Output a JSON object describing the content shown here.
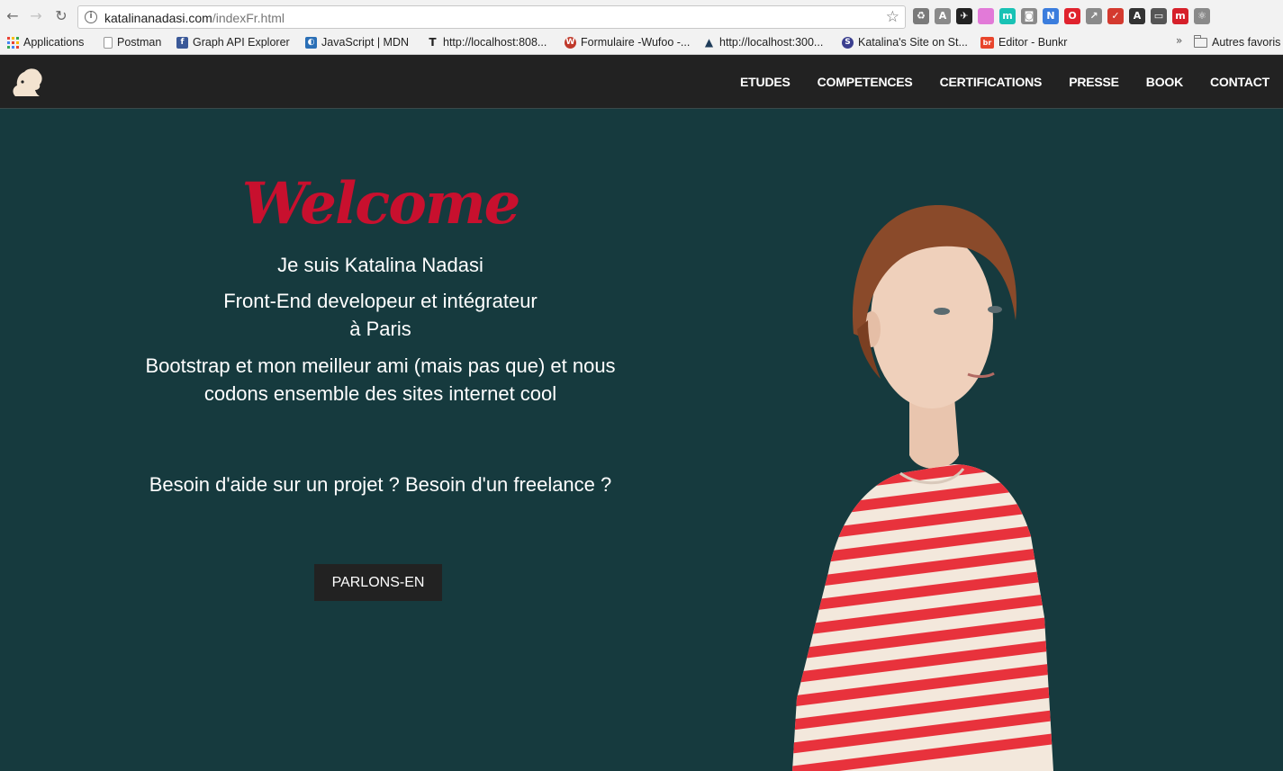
{
  "browser": {
    "url_host": "katalinanadasi.com",
    "url_path": "/indexFr.html",
    "back_icon": "arrow-left",
    "forward_icon": "arrow-right",
    "reload_icon": "reload",
    "star_icon": "star",
    "extensions": [
      {
        "name": "recycle-icon",
        "glyph": "♻",
        "color": "#7a7a7a"
      },
      {
        "name": "angular-icon",
        "glyph": "A",
        "color": "#8a8a8a"
      },
      {
        "name": "bird-icon",
        "glyph": "✈",
        "color": "#222222"
      },
      {
        "name": "gradient-icon",
        "glyph": "",
        "color": "#e27ad8"
      },
      {
        "name": "m-circle-icon",
        "glyph": "m",
        "color": "#19c2b5"
      },
      {
        "name": "camera-icon",
        "glyph": "◙",
        "color": "#8a8a8a"
      },
      {
        "name": "new-badge-icon",
        "glyph": "N",
        "color": "#3b7ddd"
      },
      {
        "name": "opera-icon",
        "glyph": "O",
        "color": "#e0232e"
      },
      {
        "name": "arrow-ext-icon",
        "glyph": "↗",
        "color": "#8a8a8a"
      },
      {
        "name": "ok-badge-icon",
        "glyph": "✓",
        "color": "#d43a2f"
      },
      {
        "name": "font-size-icon",
        "glyph": "A",
        "color": "#333333"
      },
      {
        "name": "cast-icon",
        "glyph": "▭",
        "color": "#555555"
      },
      {
        "name": "m-red-icon",
        "glyph": "m",
        "color": "#d6202a"
      },
      {
        "name": "react-icon",
        "glyph": "⚛",
        "color": "#8a8a8a"
      }
    ],
    "bookmarks": [
      {
        "label": "Applications",
        "icon": "apps-grid"
      },
      {
        "label": "Postman",
        "icon": "page"
      },
      {
        "label": "Graph API Explorer",
        "icon": "facebook"
      },
      {
        "label": "JavaScript | MDN",
        "icon": "mdn"
      },
      {
        "label": "http://localhost:808...",
        "icon": "t-logo"
      },
      {
        "label": "Formulaire -Wufoo -...",
        "icon": "wufoo"
      },
      {
        "label": "http://localhost:300...",
        "icon": "triangle"
      },
      {
        "label": "Katalina's Site on St...",
        "icon": "s-circle"
      },
      {
        "label": "Editor - Bunkr",
        "icon": "br"
      }
    ],
    "more_bookmarks": "»",
    "other_bookmarks": "Autres favoris"
  },
  "site": {
    "nav": [
      "ETUDES",
      "COMPETENCES",
      "CERTIFICATIONS",
      "PRESSE",
      "BOOK",
      "CONTACT"
    ],
    "welcome": "Welcome",
    "intro": "Je suis Katalina Nadasi",
    "role_line1": "Front-End developeur et intégrateur",
    "role_line2": "à Paris",
    "bootstrap_line1": "Bootstrap et mon meilleur ami (mais pas que) et nous",
    "bootstrap_line2": "codons ensemble des sites internet cool",
    "question": "Besoin d'aide sur un projet ? Besoin d'un freelance ?",
    "cta": "PARLONS-EN"
  },
  "colors": {
    "nav_bg": "#222222",
    "hero_bg": "#163a3e",
    "welcome": "#c8102e",
    "text": "#ffffff",
    "stripe_red": "#e8323c",
    "stripe_cream": "#f3e8dc"
  }
}
